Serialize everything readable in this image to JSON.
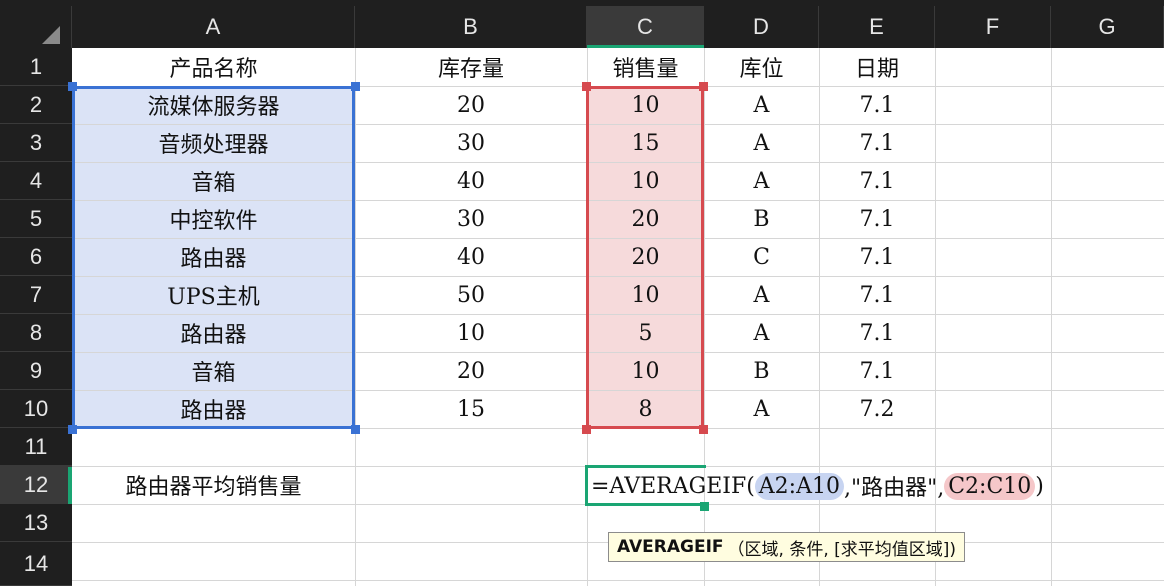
{
  "columns": [
    "A",
    "B",
    "C",
    "D",
    "E",
    "F",
    "G"
  ],
  "selected_column": "C",
  "rows": [
    "1",
    "2",
    "3",
    "4",
    "5",
    "6",
    "7",
    "8",
    "9",
    "10",
    "11",
    "12",
    "13",
    "14"
  ],
  "selected_row": "12",
  "headers": {
    "a": "产品名称",
    "b": "库存量",
    "c": "销售量",
    "d": "库位",
    "e": "日期"
  },
  "data_rows": [
    {
      "a": "流媒体服务器",
      "b": "20",
      "c": "10",
      "d": "A",
      "e": "7.1"
    },
    {
      "a": "音频处理器",
      "b": "30",
      "c": "15",
      "d": "A",
      "e": "7.1"
    },
    {
      "a": "音箱",
      "b": "40",
      "c": "10",
      "d": "A",
      "e": "7.1"
    },
    {
      "a": "中控软件",
      "b": "30",
      "c": "20",
      "d": "B",
      "e": "7.1"
    },
    {
      "a": "路由器",
      "b": "40",
      "c": "20",
      "d": "C",
      "e": "7.1"
    },
    {
      "a": "UPS主机",
      "b": "50",
      "c": "10",
      "d": "A",
      "e": "7.1"
    },
    {
      "a": "路由器",
      "b": "10",
      "c": "5",
      "d": "A",
      "e": "7.1"
    },
    {
      "a": "音箱",
      "b": "20",
      "c": "10",
      "d": "B",
      "e": "7.1"
    },
    {
      "a": "路由器",
      "b": "15",
      "c": "8",
      "d": "A",
      "e": "7.2"
    }
  ],
  "summary_label": "路由器平均销售量",
  "formula": {
    "prefix": "=AVERAGEIF(",
    "range_ref": "A2:A10",
    "criteria": ",\"路由器\",",
    "avg_ref": "C2:C10",
    "suffix": ")"
  },
  "tooltip": {
    "func": "AVERAGEIF",
    "args": "（区域, 条件, [求平均值区域])"
  },
  "colors": {
    "header_bg": "#1f1f1f",
    "selection_green": "#1aa573",
    "range_blue": "#3a72d4",
    "range_red": "#d64a4f"
  }
}
